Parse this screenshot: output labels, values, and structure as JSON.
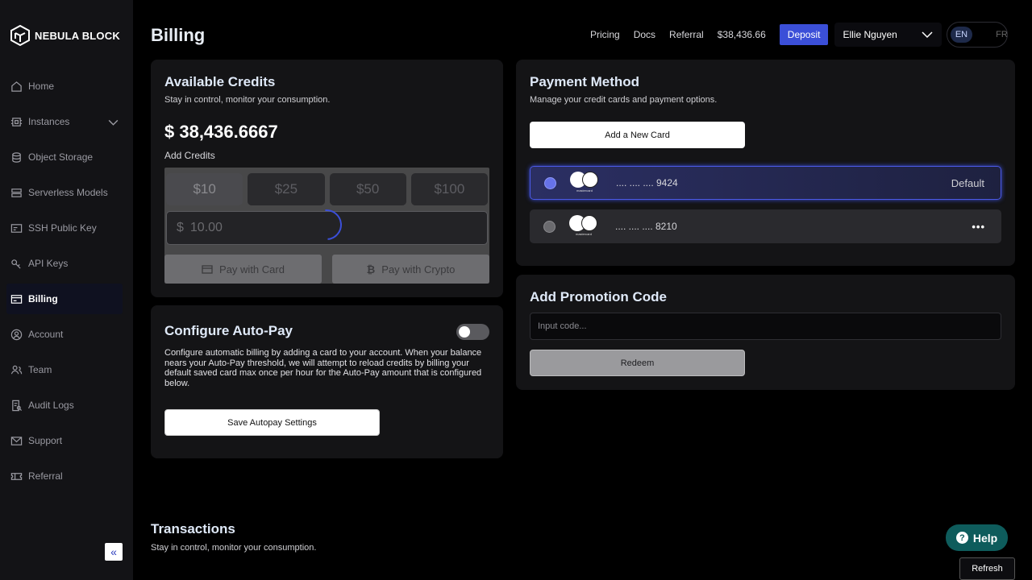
{
  "brand": {
    "name": "NEBULA BLOCK"
  },
  "sidebar": {
    "items": [
      {
        "label": "Home",
        "icon": "home-icon"
      },
      {
        "label": "Instances",
        "icon": "chip-icon"
      },
      {
        "label": "Object Storage",
        "icon": "database-icon"
      },
      {
        "label": "Serverless Models",
        "icon": "server-icon"
      },
      {
        "label": "SSH Public Key",
        "icon": "ssh-key-icon"
      },
      {
        "label": "API Keys",
        "icon": "key-icon"
      },
      {
        "label": "Billing",
        "icon": "billing-icon",
        "active": true
      },
      {
        "label": "Account",
        "icon": "user-circle-icon"
      },
      {
        "label": "Team",
        "icon": "team-icon"
      },
      {
        "label": "Audit Logs",
        "icon": "audit-log-icon"
      },
      {
        "label": "Support",
        "icon": "mail-icon"
      },
      {
        "label": "Referral",
        "icon": "ticket-icon"
      }
    ]
  },
  "header": {
    "title": "Billing",
    "links": {
      "pricing": "Pricing",
      "docs": "Docs",
      "referral": "Referral"
    },
    "balance": "$38,436.66",
    "deposit_label": "Deposit",
    "user_name": "Ellie Nguyen",
    "languages": {
      "en": "EN",
      "fr": "FR"
    },
    "accent_color": "#3b4fd8"
  },
  "credits": {
    "title": "Available Credits",
    "subtitle": "Stay in control, monitor your consumption.",
    "amount": "$ 38,436.6667",
    "add_label": "Add Credits",
    "presets": [
      "$10",
      "$25",
      "$50",
      "$100"
    ],
    "selected_preset": "$10",
    "currency_symbol": "$",
    "input_value": "10.00",
    "pay_card": "Pay with Card",
    "pay_crypto": "Pay with Crypto"
  },
  "autopay": {
    "title": "Configure Auto-Pay",
    "enabled": false,
    "description": "Configure automatic billing by adding a card to your account. When your balance nears your Auto-Pay threshold, we will attempt to reload credits by billing your default saved card max once per hour for the Auto-Pay amount that is configured below.",
    "save_label": "Save Autopay Settings"
  },
  "payment": {
    "title": "Payment Method",
    "subtitle": "Manage your credit cards and payment options.",
    "add_card_label": "Add a New Card",
    "cards": [
      {
        "number": ".... .... .... 9424",
        "brand": "mastercard",
        "tag": "Default"
      },
      {
        "number": ".... .... .... 8210",
        "brand": "mastercard",
        "tag": "..."
      }
    ]
  },
  "promo": {
    "title": "Add Promotion Code",
    "placeholder": "Input code...",
    "redeem_label": "Redeem"
  },
  "transactions": {
    "title": "Transactions",
    "subtitle": "Stay in control, monitor your consumption."
  },
  "help": {
    "label": "Help"
  },
  "refresh_label": "Refresh"
}
